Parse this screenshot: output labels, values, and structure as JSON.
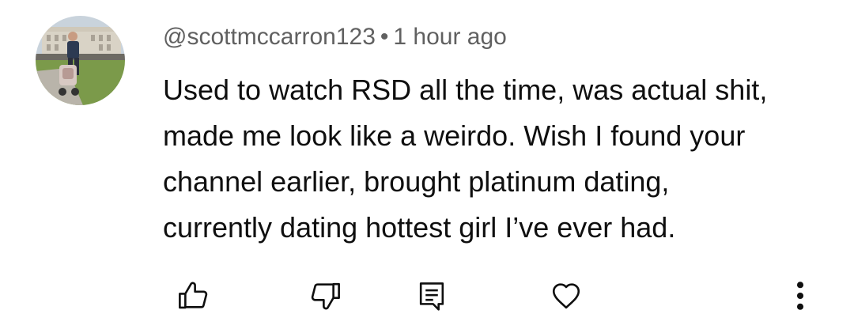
{
  "comment": {
    "author": "@scottmccarron123",
    "separator": "•",
    "timestamp": "1 hour ago",
    "text_lines": [
      "Used to watch RSD all the time, was actual shit,",
      "made me look like a weirdo. Wish I found your",
      "channel earlier, brought platinum dating,",
      "currently dating hottest girl I’ve ever had."
    ]
  },
  "actions": {
    "like_icon": "thumbs-up-icon",
    "dislike_icon": "thumbs-down-icon",
    "reply_icon": "reply-icon",
    "heart_icon": "heart-icon",
    "more_icon": "more-vertical-icon"
  },
  "colors": {
    "text": "#0f0f0f",
    "meta_text": "#606060",
    "background": "#ffffff"
  }
}
